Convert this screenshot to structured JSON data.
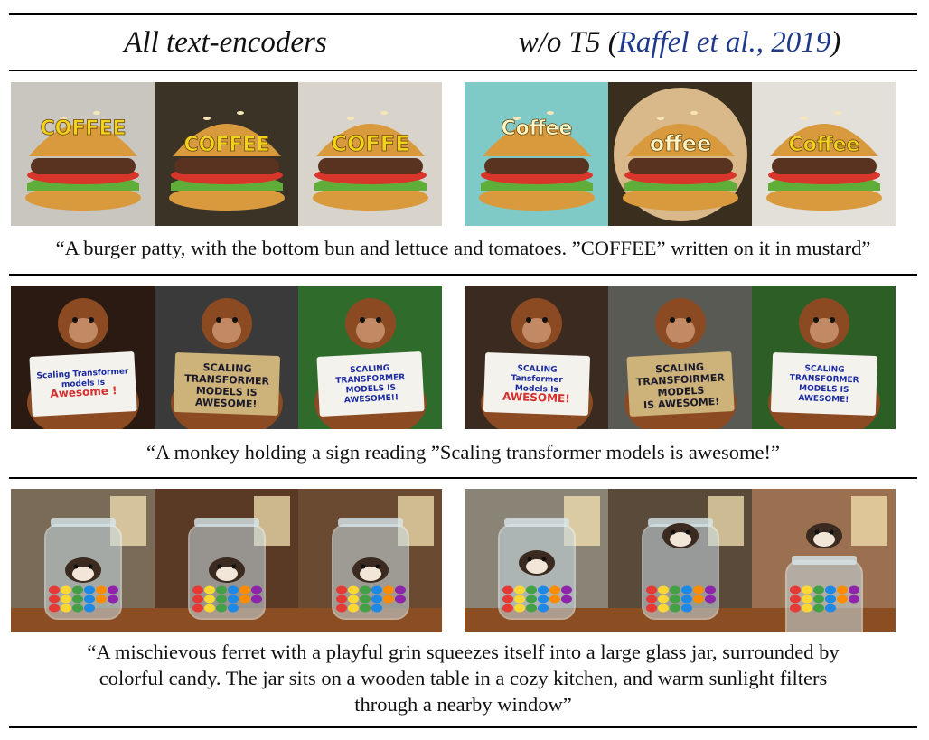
{
  "columns": {
    "left_title": "All text-encoders",
    "right_title_prefix": "w/o T5 (",
    "right_title_cite": "Raffel et al., 2019",
    "right_title_suffix": ")"
  },
  "rows": [
    {
      "caption": "“A burger patty, with the bottom bun and lettuce and tomatoes. ”COFFEE” written on it in mustard”",
      "left_images": [
        {
          "sign_text": "COFFEE"
        },
        {
          "sign_text": "COFFEE"
        },
        {
          "sign_text": "COFFE"
        }
      ],
      "right_images": [
        {
          "sign_text": "Coffee"
        },
        {
          "sign_text": "offee"
        },
        {
          "sign_text": "Coffee"
        }
      ]
    },
    {
      "caption": "“A monkey holding a sign reading ”Scaling transformer models is awesome!”",
      "left_images": [
        {
          "sign_line1": "Scaling Transformer",
          "sign_line2": "models is",
          "sign_line3": "Awesome !"
        },
        {
          "sign_line1": "SCALING",
          "sign_line2": "TRANSFORMER",
          "sign_line3": "MODELS IS",
          "sign_line4": "AWESOME!"
        },
        {
          "sign_line1": "SCALING",
          "sign_line2": "TRANSFORMER",
          "sign_line3": "MODELS IS",
          "sign_line4": "AWESOME!!"
        }
      ],
      "right_images": [
        {
          "sign_line1": "SCALING",
          "sign_line2": "Tansformer",
          "sign_line3": "Models Is",
          "sign_line4": "AWESOME!"
        },
        {
          "sign_line1": "SCALING",
          "sign_line2": "TRANSFOIRMER",
          "sign_line3": "MODELS",
          "sign_line4": "IS AWESOME!"
        },
        {
          "sign_line1": "SCALING",
          "sign_line2": "TRANSFORMER",
          "sign_line3": "MODELS IS",
          "sign_line4": "AWESOME!"
        }
      ]
    },
    {
      "caption_line1": "“A mischievous ferret with a playful grin squeezes itself into a large glass jar, surrounded by",
      "caption_line2": "colorful candy. The jar sits on a wooden table in a cozy kitchen, and warm sunlight filters",
      "caption_line3": "through a nearby window”"
    }
  ],
  "colors": {
    "bun": "#d99a3e",
    "patty": "#5a3320",
    "lettuce": "#5fae3a",
    "tomato": "#d9362b",
    "mustard": "#f2d21c",
    "monkey_fur": "#8b4a22",
    "sign_paper": "#f4f2ec",
    "cardboard": "#cdb27a",
    "wood": "#8a4e22",
    "glass": "#c9dde6",
    "candy": [
      "#e53935",
      "#fdd835",
      "#43a047",
      "#1e88e5",
      "#fb8c00",
      "#8e24aa"
    ]
  }
}
